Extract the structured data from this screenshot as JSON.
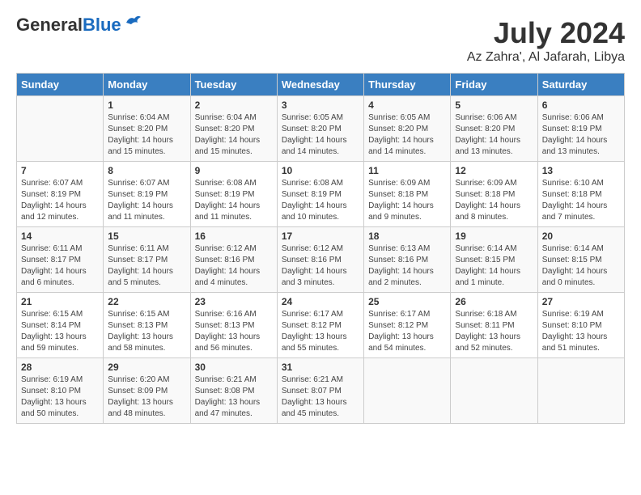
{
  "header": {
    "logo_general": "General",
    "logo_blue": "Blue",
    "title": "July 2024",
    "location": "Az Zahra', Al Jafarah, Libya"
  },
  "calendar": {
    "days_of_week": [
      "Sunday",
      "Monday",
      "Tuesday",
      "Wednesday",
      "Thursday",
      "Friday",
      "Saturday"
    ],
    "weeks": [
      [
        {
          "day": "",
          "info": ""
        },
        {
          "day": "1",
          "info": "Sunrise: 6:04 AM\nSunset: 8:20 PM\nDaylight: 14 hours and 15 minutes."
        },
        {
          "day": "2",
          "info": "Sunrise: 6:04 AM\nSunset: 8:20 PM\nDaylight: 14 hours and 15 minutes."
        },
        {
          "day": "3",
          "info": "Sunrise: 6:05 AM\nSunset: 8:20 PM\nDaylight: 14 hours and 14 minutes."
        },
        {
          "day": "4",
          "info": "Sunrise: 6:05 AM\nSunset: 8:20 PM\nDaylight: 14 hours and 14 minutes."
        },
        {
          "day": "5",
          "info": "Sunrise: 6:06 AM\nSunset: 8:20 PM\nDaylight: 14 hours and 13 minutes."
        },
        {
          "day": "6",
          "info": "Sunrise: 6:06 AM\nSunset: 8:19 PM\nDaylight: 14 hours and 13 minutes."
        }
      ],
      [
        {
          "day": "7",
          "info": "Sunrise: 6:07 AM\nSunset: 8:19 PM\nDaylight: 14 hours and 12 minutes."
        },
        {
          "day": "8",
          "info": "Sunrise: 6:07 AM\nSunset: 8:19 PM\nDaylight: 14 hours and 11 minutes."
        },
        {
          "day": "9",
          "info": "Sunrise: 6:08 AM\nSunset: 8:19 PM\nDaylight: 14 hours and 11 minutes."
        },
        {
          "day": "10",
          "info": "Sunrise: 6:08 AM\nSunset: 8:19 PM\nDaylight: 14 hours and 10 minutes."
        },
        {
          "day": "11",
          "info": "Sunrise: 6:09 AM\nSunset: 8:18 PM\nDaylight: 14 hours and 9 minutes."
        },
        {
          "day": "12",
          "info": "Sunrise: 6:09 AM\nSunset: 8:18 PM\nDaylight: 14 hours and 8 minutes."
        },
        {
          "day": "13",
          "info": "Sunrise: 6:10 AM\nSunset: 8:18 PM\nDaylight: 14 hours and 7 minutes."
        }
      ],
      [
        {
          "day": "14",
          "info": "Sunrise: 6:11 AM\nSunset: 8:17 PM\nDaylight: 14 hours and 6 minutes."
        },
        {
          "day": "15",
          "info": "Sunrise: 6:11 AM\nSunset: 8:17 PM\nDaylight: 14 hours and 5 minutes."
        },
        {
          "day": "16",
          "info": "Sunrise: 6:12 AM\nSunset: 8:16 PM\nDaylight: 14 hours and 4 minutes."
        },
        {
          "day": "17",
          "info": "Sunrise: 6:12 AM\nSunset: 8:16 PM\nDaylight: 14 hours and 3 minutes."
        },
        {
          "day": "18",
          "info": "Sunrise: 6:13 AM\nSunset: 8:16 PM\nDaylight: 14 hours and 2 minutes."
        },
        {
          "day": "19",
          "info": "Sunrise: 6:14 AM\nSunset: 8:15 PM\nDaylight: 14 hours and 1 minute."
        },
        {
          "day": "20",
          "info": "Sunrise: 6:14 AM\nSunset: 8:15 PM\nDaylight: 14 hours and 0 minutes."
        }
      ],
      [
        {
          "day": "21",
          "info": "Sunrise: 6:15 AM\nSunset: 8:14 PM\nDaylight: 13 hours and 59 minutes."
        },
        {
          "day": "22",
          "info": "Sunrise: 6:15 AM\nSunset: 8:13 PM\nDaylight: 13 hours and 58 minutes."
        },
        {
          "day": "23",
          "info": "Sunrise: 6:16 AM\nSunset: 8:13 PM\nDaylight: 13 hours and 56 minutes."
        },
        {
          "day": "24",
          "info": "Sunrise: 6:17 AM\nSunset: 8:12 PM\nDaylight: 13 hours and 55 minutes."
        },
        {
          "day": "25",
          "info": "Sunrise: 6:17 AM\nSunset: 8:12 PM\nDaylight: 13 hours and 54 minutes."
        },
        {
          "day": "26",
          "info": "Sunrise: 6:18 AM\nSunset: 8:11 PM\nDaylight: 13 hours and 52 minutes."
        },
        {
          "day": "27",
          "info": "Sunrise: 6:19 AM\nSunset: 8:10 PM\nDaylight: 13 hours and 51 minutes."
        }
      ],
      [
        {
          "day": "28",
          "info": "Sunrise: 6:19 AM\nSunset: 8:10 PM\nDaylight: 13 hours and 50 minutes."
        },
        {
          "day": "29",
          "info": "Sunrise: 6:20 AM\nSunset: 8:09 PM\nDaylight: 13 hours and 48 minutes."
        },
        {
          "day": "30",
          "info": "Sunrise: 6:21 AM\nSunset: 8:08 PM\nDaylight: 13 hours and 47 minutes."
        },
        {
          "day": "31",
          "info": "Sunrise: 6:21 AM\nSunset: 8:07 PM\nDaylight: 13 hours and 45 minutes."
        },
        {
          "day": "",
          "info": ""
        },
        {
          "day": "",
          "info": ""
        },
        {
          "day": "",
          "info": ""
        }
      ]
    ]
  }
}
